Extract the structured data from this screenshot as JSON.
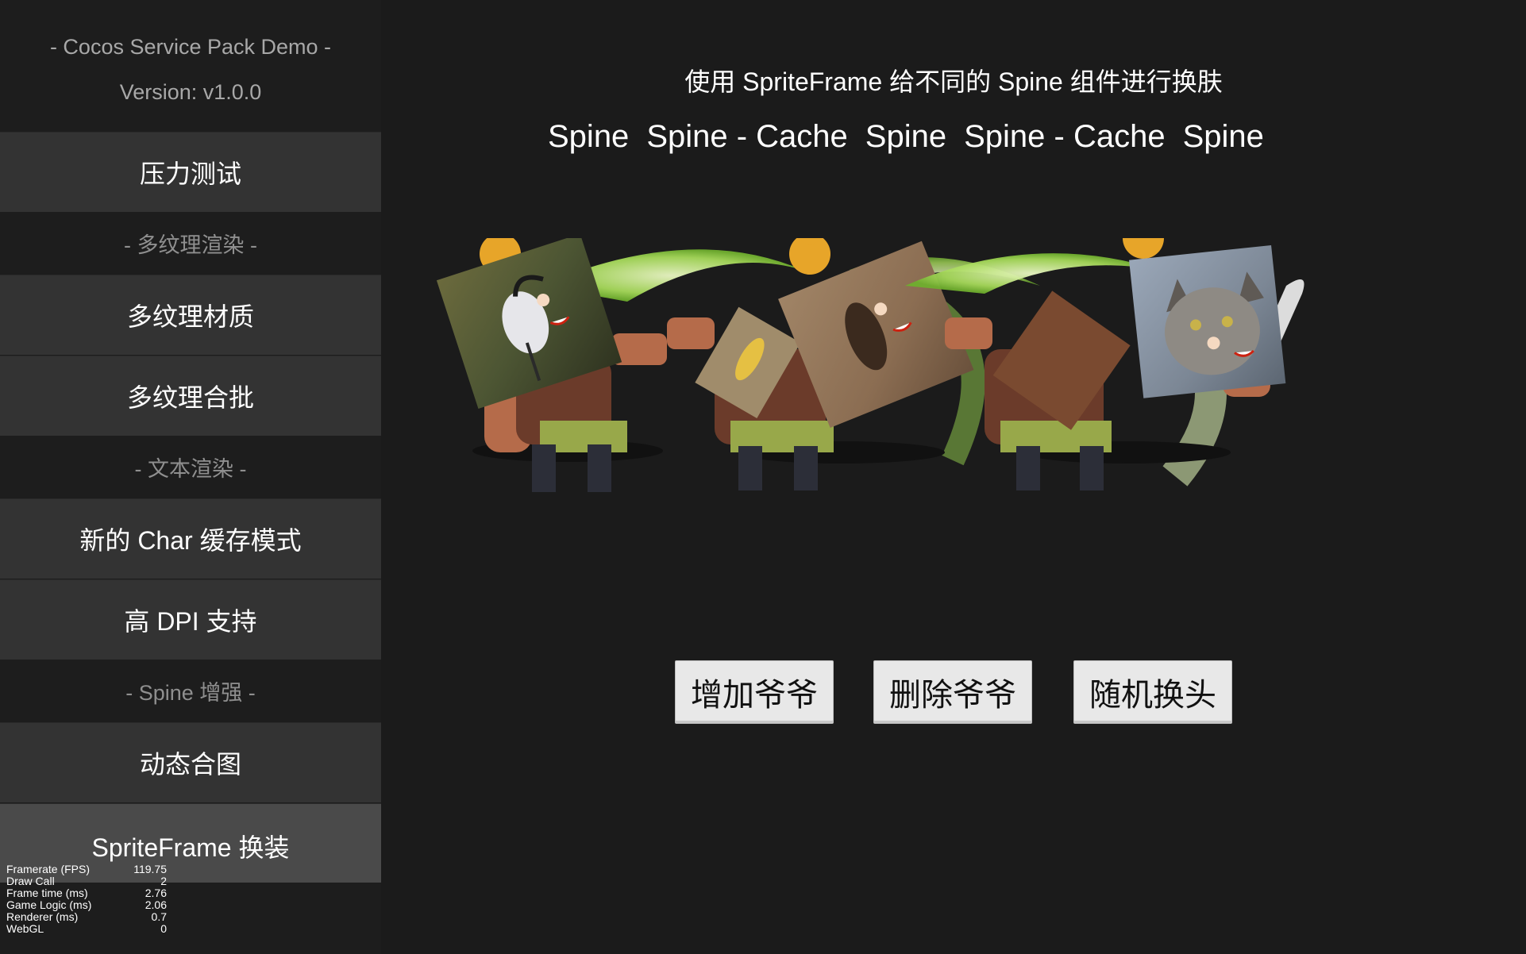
{
  "sidebar": {
    "title": "- Cocos Service Pack Demo -",
    "version": "Version: v1.0.0",
    "items": [
      {
        "type": "button",
        "label": "压力测试"
      },
      {
        "type": "section",
        "label": "- 多纹理渲染 -"
      },
      {
        "type": "button",
        "label": "多纹理材质"
      },
      {
        "type": "button",
        "label": "多纹理合批"
      },
      {
        "type": "section",
        "label": "- 文本渲染 -"
      },
      {
        "type": "button",
        "label": "新的 Char 缓存模式"
      },
      {
        "type": "button",
        "label": "高 DPI 支持"
      },
      {
        "type": "section",
        "label": "- Spine 增强 -"
      },
      {
        "type": "button",
        "label": "动态合图"
      },
      {
        "type": "button",
        "label": "SpriteFrame 换装",
        "active": true
      }
    ]
  },
  "stats": [
    {
      "label": "Framerate (FPS)",
      "value": "119.75"
    },
    {
      "label": "Draw Call",
      "value": "2"
    },
    {
      "label": "Frame time (ms)",
      "value": "2.76"
    },
    {
      "label": "Game Logic (ms)",
      "value": "2.06"
    },
    {
      "label": "Renderer (ms)",
      "value": "0.7"
    },
    {
      "label": "WebGL",
      "value": "0"
    }
  ],
  "main": {
    "heading": "使用 SpriteFrame 给不同的 Spine 组件进行换肤",
    "labels": [
      "Spine",
      "Spine - Cache",
      "Spine",
      "Spine - Cache",
      "Spine"
    ],
    "buttons": {
      "add": "增加爷爷",
      "remove": "删除爷爷",
      "random": "随机换头"
    }
  },
  "colors": {
    "background": "#1b1b1b",
    "menu_button": "#333333",
    "menu_button_active": "#4a4a4a",
    "action_button": "#e8e8e8"
  }
}
